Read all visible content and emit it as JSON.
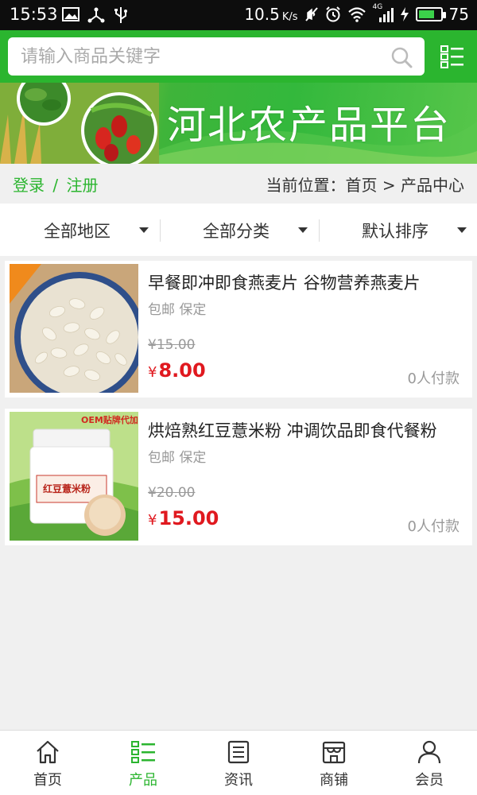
{
  "status_bar": {
    "time": "15:53",
    "network_speed": "10.5",
    "network_unit": "K/s",
    "battery_level": "75",
    "signal_label": "4G"
  },
  "search": {
    "placeholder": "请输入商品关键字"
  },
  "banner": {
    "title": "河北农产品平台"
  },
  "location_bar": {
    "login": "登录",
    "separator": "/",
    "register": "注册",
    "breadcrumb": "当前位置：首页 > 产品中心"
  },
  "filters": [
    {
      "label": "全部地区"
    },
    {
      "label": "全部分类"
    },
    {
      "label": "默认排序"
    }
  ],
  "products": [
    {
      "title": "早餐即冲即食燕麦片 谷物营养燕麦片",
      "tags": "包邮 保定",
      "old_price": "¥15.00",
      "currency": "¥",
      "price": "8.00",
      "sold": "0人付款"
    },
    {
      "title": "烘焙熟红豆薏米粉 冲调饮品即食代餐粉",
      "tags": "包邮 保定",
      "old_price": "¥20.00",
      "currency": "¥",
      "price": "15.00",
      "sold": "0人付款",
      "image_text": {
        "oem": "OEM贴牌代加",
        "jar_label": "红豆薏米粉"
      }
    }
  ],
  "bottom_nav": [
    {
      "label": "首页",
      "icon": "home-icon"
    },
    {
      "label": "产品",
      "icon": "list-icon",
      "active": true
    },
    {
      "label": "资讯",
      "icon": "news-icon"
    },
    {
      "label": "商铺",
      "icon": "shop-icon"
    },
    {
      "label": "会员",
      "icon": "user-icon"
    }
  ],
  "colors": {
    "brand_green": "#2bb52f",
    "price_red": "#e0191f",
    "status_bar": "#0d0d0d"
  }
}
